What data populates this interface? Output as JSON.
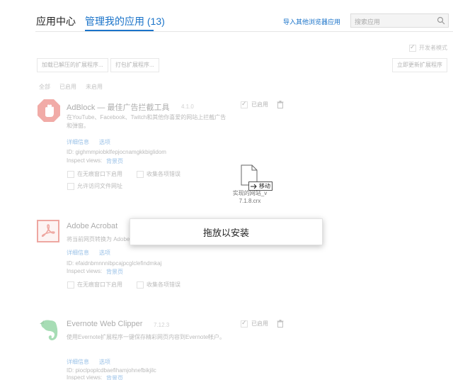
{
  "header": {
    "tab_app_center": "应用中心",
    "tab_manage": "管理我的应用 (13)",
    "import_link": "导入其他浏览器应用",
    "search_placeholder": "搜索应用"
  },
  "toolbar": {
    "dev_mode_label": "开发者模式",
    "load_unpacked": "加载已解压的扩展程序...",
    "pack_extension": "打包扩展程序...",
    "update_now": "立即更新扩展程序"
  },
  "filters": [
    "全部",
    "已启用",
    "未启用"
  ],
  "extensions": [
    {
      "name": "AdBlock — 最佳广告拦截工具",
      "version": "4.1.0",
      "desc": "在YouTube、Facebook、Twitch和其他你喜爱的网站上拦截广告和弹窗。",
      "details": "详细信息",
      "options": "选项",
      "id": "ID: gighmmpiobklfepjocnamgkkbiglidom",
      "inspect": "Inspect views:",
      "inspect_link": "背景页",
      "opt_incognito": "在无痕窗口下启用",
      "opt_errors": "收集各项错误",
      "opt_files": "允许访问文件网址",
      "enabled": "已启用"
    },
    {
      "name": "Adobe Acrobat",
      "desc": "将当前网页转换为 Adobe PDF",
      "details": "详细信息",
      "options": "选项",
      "id": "ID: efaidnbmnnnibpcajpcglclefindmkaj",
      "inspect": "Inspect views:",
      "inspect_link": "背景页",
      "opt_incognito": "在无痕窗口下启用",
      "opt_errors": "收集各项错误"
    },
    {
      "name": "Evernote Web Clipper",
      "version": "7.12.3",
      "desc": "使用Evernote扩展程序一键保存精彩网页内容到Evernote帐户。",
      "details": "详细信息",
      "options": "选项",
      "id": "ID: pioclpoplcdbaefihamjohnefbikjilc",
      "inspect": "Inspect views:",
      "inspect_link": "背景页",
      "enabled": "已启用"
    }
  ],
  "drag": {
    "move_label": "移动",
    "file_name_line1": "实现的网站_v",
    "file_name_line2": "7.1.8.crx"
  },
  "drop_overlay": {
    "label": "拖放以安装"
  }
}
